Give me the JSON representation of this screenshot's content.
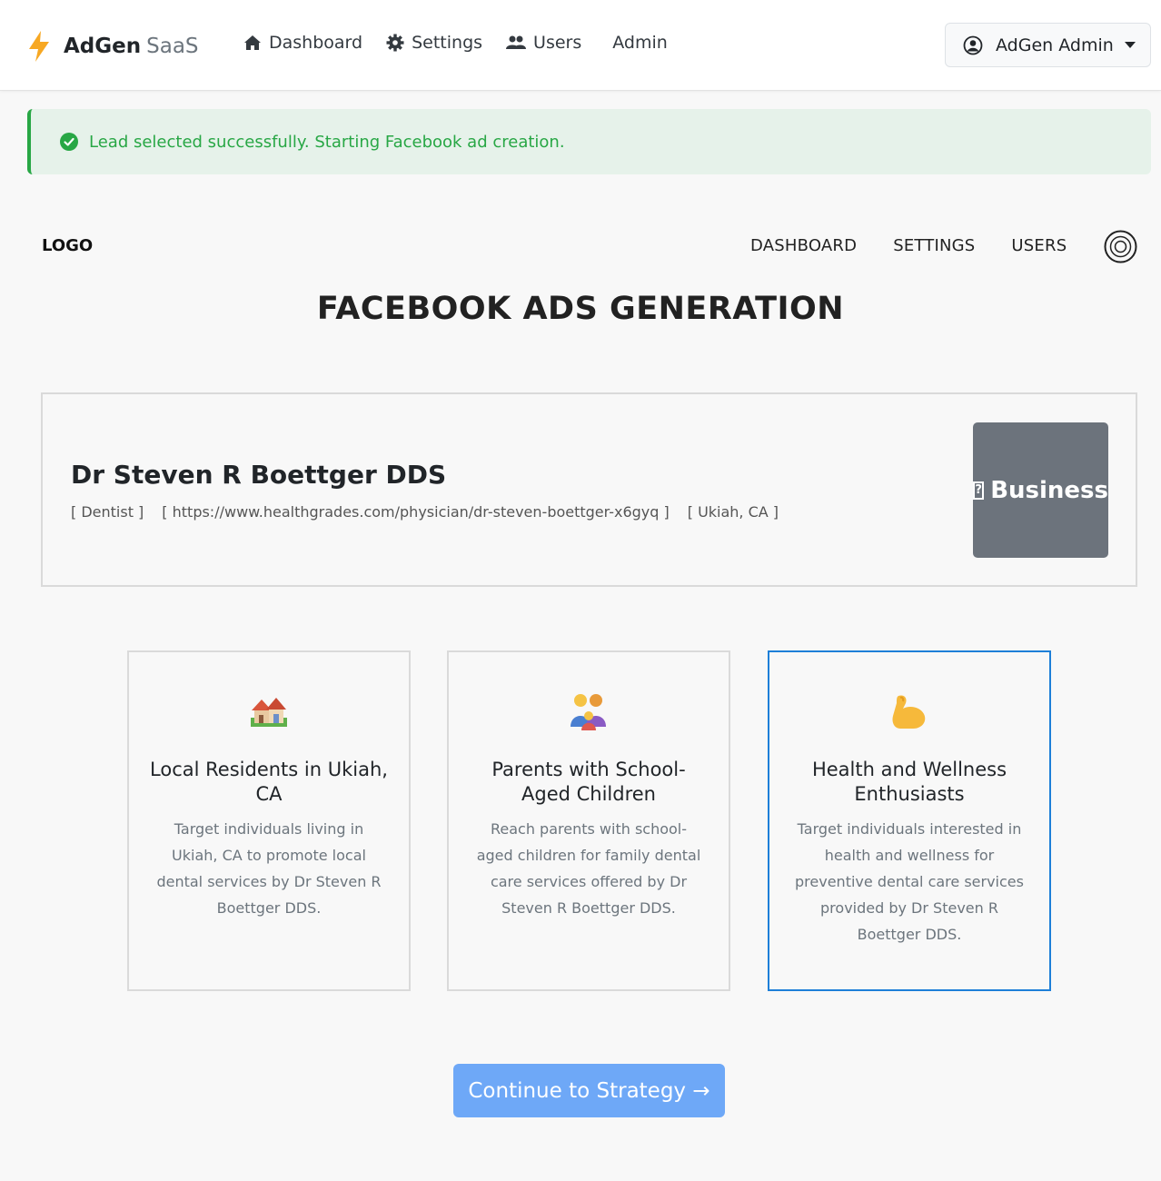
{
  "brand": {
    "name_bold": "AdGen",
    "name_light": "SaaS",
    "accent": "#f7a823"
  },
  "topnav": {
    "items": [
      {
        "label": "Dashboard",
        "icon": "home-icon"
      },
      {
        "label": "Settings",
        "icon": "gear-icon"
      },
      {
        "label": "Users",
        "icon": "users-icon"
      },
      {
        "label": "Admin",
        "icon": ""
      }
    ],
    "user_menu": {
      "label": "AdGen Admin",
      "icon": "user-circle-icon"
    }
  },
  "alert": {
    "message": "Lead selected successfully. Starting Facebook ad creation.",
    "color": "#28a745"
  },
  "inner_nav": {
    "logo": "LOGO",
    "links": [
      "DASHBOARD",
      "SETTINGS",
      "USERS"
    ]
  },
  "page_title": "FACEBOOK ADS GENERATION",
  "business": {
    "name": "Dr Steven R Boettger DDS",
    "category": "[ Dentist ]",
    "url": "[ https://www.healthgrades.com/physician/dr-steven-boettger-x6gyq ]",
    "location": "[ Ukiah, CA ]",
    "image_label": "Business",
    "image_glyph": "?"
  },
  "audiences": [
    {
      "icon": "houses-icon",
      "title": "Local Residents in Ukiah, CA",
      "description": "Target individuals living in Ukiah, CA to promote local dental services by Dr Steven R Boettger DDS.",
      "selected": false
    },
    {
      "icon": "family-icon",
      "title": "Parents with School-Aged Children",
      "description": "Reach parents with school-aged children for family dental care services offered by Dr Steven R Boettger DDS.",
      "selected": false
    },
    {
      "icon": "flexed-biceps-icon",
      "title": "Health and Wellness Enthusiasts",
      "description": "Target individuals interested in health and wellness for preventive dental care services provided by Dr Steven R Boettger DDS.",
      "selected": true
    }
  ],
  "continue_button": {
    "label": "Continue to Strategy →",
    "color": "#6ea8f7"
  }
}
